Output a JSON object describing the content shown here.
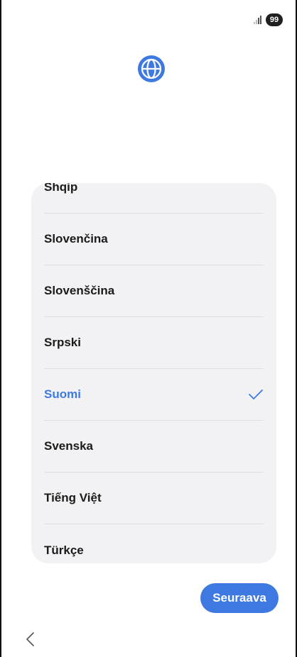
{
  "status_bar": {
    "battery_level": "99",
    "signal_icon": "signal-bars-icon"
  },
  "header": {
    "icon": "globe-icon",
    "accent_color": "#3e79e1"
  },
  "language_list": {
    "items": [
      {
        "label": "Shqip",
        "selected": false
      },
      {
        "label": "Slovenčina",
        "selected": false
      },
      {
        "label": "Slovenščina",
        "selected": false
      },
      {
        "label": "Srpski",
        "selected": false
      },
      {
        "label": "Suomi",
        "selected": true
      },
      {
        "label": "Svenska",
        "selected": false
      },
      {
        "label": "Tiếng Việt",
        "selected": false
      },
      {
        "label": "Türkçe",
        "selected": false
      }
    ]
  },
  "footer": {
    "next_label": "Seuraava",
    "back_icon": "chevron-left-icon"
  }
}
